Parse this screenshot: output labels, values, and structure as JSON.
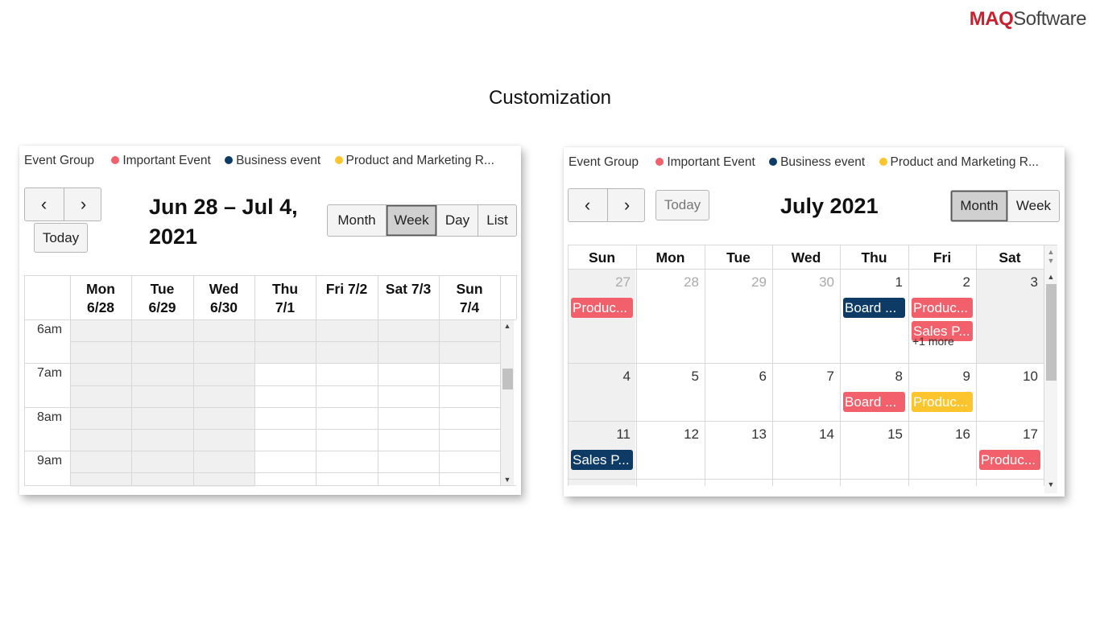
{
  "brand": {
    "logo_bold": "MAQ",
    "logo_rest": "Software"
  },
  "page_title": "Customization",
  "colors": {
    "important": "#f2616b",
    "business": "#0e3b66",
    "product": "#fdc52d"
  },
  "legend": {
    "title": "Event Group",
    "items": [
      {
        "label": "Important Event",
        "color": "#f2616b"
      },
      {
        "label": "Business event",
        "color": "#0e3b66"
      },
      {
        "label": "Product and Marketing R...",
        "color": "#fdc52d"
      }
    ]
  },
  "week_view": {
    "prev_icon": "‹",
    "next_icon": "›",
    "today_label": "Today",
    "title_line1": "Jun 28 – Jul 4,",
    "title_line2": "2021",
    "views": [
      "Month",
      "Week",
      "Day",
      "List"
    ],
    "active_view": "Week",
    "columns": [
      {
        "l1": "Mon",
        "l2": "6/28"
      },
      {
        "l1": "Tue",
        "l2": "6/29"
      },
      {
        "l1": "Wed",
        "l2": "6/30"
      },
      {
        "l1": "Thu",
        "l2": "7/1"
      },
      {
        "l1": "Fri 7/2",
        "l2": ""
      },
      {
        "l1": "Sat 7/3",
        "l2": ""
      },
      {
        "l1": "Sun",
        "l2": "7/4"
      }
    ],
    "times": [
      "6am",
      "7am",
      "8am",
      "9am"
    ]
  },
  "month_view": {
    "prev_icon": "‹",
    "next_icon": "›",
    "today_label": "Today",
    "title": "July 2021",
    "views": [
      "Month",
      "Week"
    ],
    "active_view": "Month",
    "weekdays": [
      "Sun",
      "Mon",
      "Tue",
      "Wed",
      "Thu",
      "Fri",
      "Sat"
    ],
    "weeks": [
      {
        "days": [
          {
            "num": "27",
            "other": true
          },
          {
            "num": "28",
            "other": true
          },
          {
            "num": "29",
            "other": true
          },
          {
            "num": "30",
            "other": true
          },
          {
            "num": "1"
          },
          {
            "num": "2"
          },
          {
            "num": "3"
          }
        ],
        "events": [
          {
            "day": 0,
            "slot": 0,
            "label": "Produc...",
            "group": "important"
          },
          {
            "day": 4,
            "slot": 0,
            "label": "Board ...",
            "group": "business"
          },
          {
            "day": 5,
            "slot": 0,
            "label": "Produc...",
            "group": "important"
          },
          {
            "day": 5,
            "slot": 1,
            "label": "Sales P...",
            "group": "important"
          }
        ],
        "more": [
          {
            "day": 5,
            "label": "+1 more"
          }
        ]
      },
      {
        "days": [
          {
            "num": "4"
          },
          {
            "num": "5"
          },
          {
            "num": "6"
          },
          {
            "num": "7"
          },
          {
            "num": "8"
          },
          {
            "num": "9"
          },
          {
            "num": "10"
          }
        ],
        "events": [
          {
            "day": 4,
            "slot": 0,
            "label": "Board ...",
            "group": "important"
          },
          {
            "day": 5,
            "slot": 0,
            "label": "Produc...",
            "group": "product"
          }
        ],
        "more": []
      },
      {
        "days": [
          {
            "num": "11"
          },
          {
            "num": "12"
          },
          {
            "num": "13"
          },
          {
            "num": "14"
          },
          {
            "num": "15"
          },
          {
            "num": "16"
          },
          {
            "num": "17"
          }
        ],
        "events": [
          {
            "day": 0,
            "slot": 0,
            "label": "Sales P...",
            "group": "business"
          },
          {
            "day": 6,
            "slot": 0,
            "label": "Produc...",
            "group": "important"
          }
        ],
        "more": []
      }
    ]
  }
}
